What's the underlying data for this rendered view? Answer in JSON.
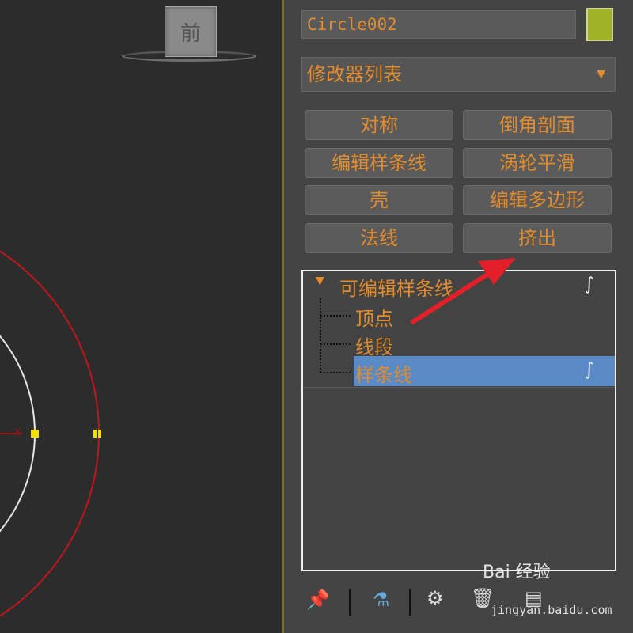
{
  "viewport": {
    "viewcube_face": "前",
    "axis_label": "X"
  },
  "panel": {
    "object_name": "Circle002",
    "object_color": "#a0b326",
    "modifier_list": "修改器列表",
    "modifier_buttons": [
      "对称",
      "倒角剖面",
      "编辑样条线",
      "涡轮平滑",
      "壳",
      "编辑多边形",
      "法线",
      "挤出"
    ],
    "stack": {
      "root": "可编辑样条线",
      "children": [
        "顶点",
        "线段",
        "样条线"
      ],
      "selected_child": "样条线"
    },
    "toolbar_icons": [
      "pin-icon",
      "test-tube-icon",
      "config-icon",
      "trash-icon",
      "config-sets-icon"
    ]
  },
  "colors": {
    "accent": "#e18b2c",
    "selection": "#5b8bc7",
    "spline_red": "#c3161c"
  },
  "watermark": {
    "brand": "Bai 经验",
    "site": "jingyan.baidu.com"
  }
}
